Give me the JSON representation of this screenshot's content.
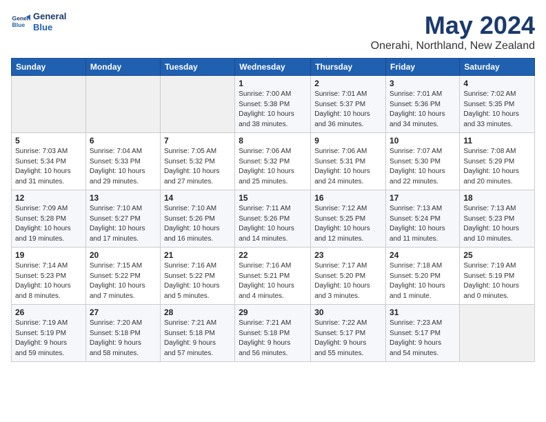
{
  "header": {
    "logo_line1": "General",
    "logo_line2": "Blue",
    "title": "May 2024",
    "subtitle": "Onerahi, Northland, New Zealand"
  },
  "weekdays": [
    "Sunday",
    "Monday",
    "Tuesday",
    "Wednesday",
    "Thursday",
    "Friday",
    "Saturday"
  ],
  "weeks": [
    [
      {
        "day": "",
        "info": ""
      },
      {
        "day": "",
        "info": ""
      },
      {
        "day": "",
        "info": ""
      },
      {
        "day": "1",
        "info": "Sunrise: 7:00 AM\nSunset: 5:38 PM\nDaylight: 10 hours\nand 38 minutes."
      },
      {
        "day": "2",
        "info": "Sunrise: 7:01 AM\nSunset: 5:37 PM\nDaylight: 10 hours\nand 36 minutes."
      },
      {
        "day": "3",
        "info": "Sunrise: 7:01 AM\nSunset: 5:36 PM\nDaylight: 10 hours\nand 34 minutes."
      },
      {
        "day": "4",
        "info": "Sunrise: 7:02 AM\nSunset: 5:35 PM\nDaylight: 10 hours\nand 33 minutes."
      }
    ],
    [
      {
        "day": "5",
        "info": "Sunrise: 7:03 AM\nSunset: 5:34 PM\nDaylight: 10 hours\nand 31 minutes."
      },
      {
        "day": "6",
        "info": "Sunrise: 7:04 AM\nSunset: 5:33 PM\nDaylight: 10 hours\nand 29 minutes."
      },
      {
        "day": "7",
        "info": "Sunrise: 7:05 AM\nSunset: 5:32 PM\nDaylight: 10 hours\nand 27 minutes."
      },
      {
        "day": "8",
        "info": "Sunrise: 7:06 AM\nSunset: 5:32 PM\nDaylight: 10 hours\nand 25 minutes."
      },
      {
        "day": "9",
        "info": "Sunrise: 7:06 AM\nSunset: 5:31 PM\nDaylight: 10 hours\nand 24 minutes."
      },
      {
        "day": "10",
        "info": "Sunrise: 7:07 AM\nSunset: 5:30 PM\nDaylight: 10 hours\nand 22 minutes."
      },
      {
        "day": "11",
        "info": "Sunrise: 7:08 AM\nSunset: 5:29 PM\nDaylight: 10 hours\nand 20 minutes."
      }
    ],
    [
      {
        "day": "12",
        "info": "Sunrise: 7:09 AM\nSunset: 5:28 PM\nDaylight: 10 hours\nand 19 minutes."
      },
      {
        "day": "13",
        "info": "Sunrise: 7:10 AM\nSunset: 5:27 PM\nDaylight: 10 hours\nand 17 minutes."
      },
      {
        "day": "14",
        "info": "Sunrise: 7:10 AM\nSunset: 5:26 PM\nDaylight: 10 hours\nand 16 minutes."
      },
      {
        "day": "15",
        "info": "Sunrise: 7:11 AM\nSunset: 5:26 PM\nDaylight: 10 hours\nand 14 minutes."
      },
      {
        "day": "16",
        "info": "Sunrise: 7:12 AM\nSunset: 5:25 PM\nDaylight: 10 hours\nand 12 minutes."
      },
      {
        "day": "17",
        "info": "Sunrise: 7:13 AM\nSunset: 5:24 PM\nDaylight: 10 hours\nand 11 minutes."
      },
      {
        "day": "18",
        "info": "Sunrise: 7:13 AM\nSunset: 5:23 PM\nDaylight: 10 hours\nand 10 minutes."
      }
    ],
    [
      {
        "day": "19",
        "info": "Sunrise: 7:14 AM\nSunset: 5:23 PM\nDaylight: 10 hours\nand 8 minutes."
      },
      {
        "day": "20",
        "info": "Sunrise: 7:15 AM\nSunset: 5:22 PM\nDaylight: 10 hours\nand 7 minutes."
      },
      {
        "day": "21",
        "info": "Sunrise: 7:16 AM\nSunset: 5:22 PM\nDaylight: 10 hours\nand 5 minutes."
      },
      {
        "day": "22",
        "info": "Sunrise: 7:16 AM\nSunset: 5:21 PM\nDaylight: 10 hours\nand 4 minutes."
      },
      {
        "day": "23",
        "info": "Sunrise: 7:17 AM\nSunset: 5:20 PM\nDaylight: 10 hours\nand 3 minutes."
      },
      {
        "day": "24",
        "info": "Sunrise: 7:18 AM\nSunset: 5:20 PM\nDaylight: 10 hours\nand 1 minute."
      },
      {
        "day": "25",
        "info": "Sunrise: 7:19 AM\nSunset: 5:19 PM\nDaylight: 10 hours\nand 0 minutes."
      }
    ],
    [
      {
        "day": "26",
        "info": "Sunrise: 7:19 AM\nSunset: 5:19 PM\nDaylight: 9 hours\nand 59 minutes."
      },
      {
        "day": "27",
        "info": "Sunrise: 7:20 AM\nSunset: 5:18 PM\nDaylight: 9 hours\nand 58 minutes."
      },
      {
        "day": "28",
        "info": "Sunrise: 7:21 AM\nSunset: 5:18 PM\nDaylight: 9 hours\nand 57 minutes."
      },
      {
        "day": "29",
        "info": "Sunrise: 7:21 AM\nSunset: 5:18 PM\nDaylight: 9 hours\nand 56 minutes."
      },
      {
        "day": "30",
        "info": "Sunrise: 7:22 AM\nSunset: 5:17 PM\nDaylight: 9 hours\nand 55 minutes."
      },
      {
        "day": "31",
        "info": "Sunrise: 7:23 AM\nSunset: 5:17 PM\nDaylight: 9 hours\nand 54 minutes."
      },
      {
        "day": "",
        "info": ""
      }
    ]
  ]
}
